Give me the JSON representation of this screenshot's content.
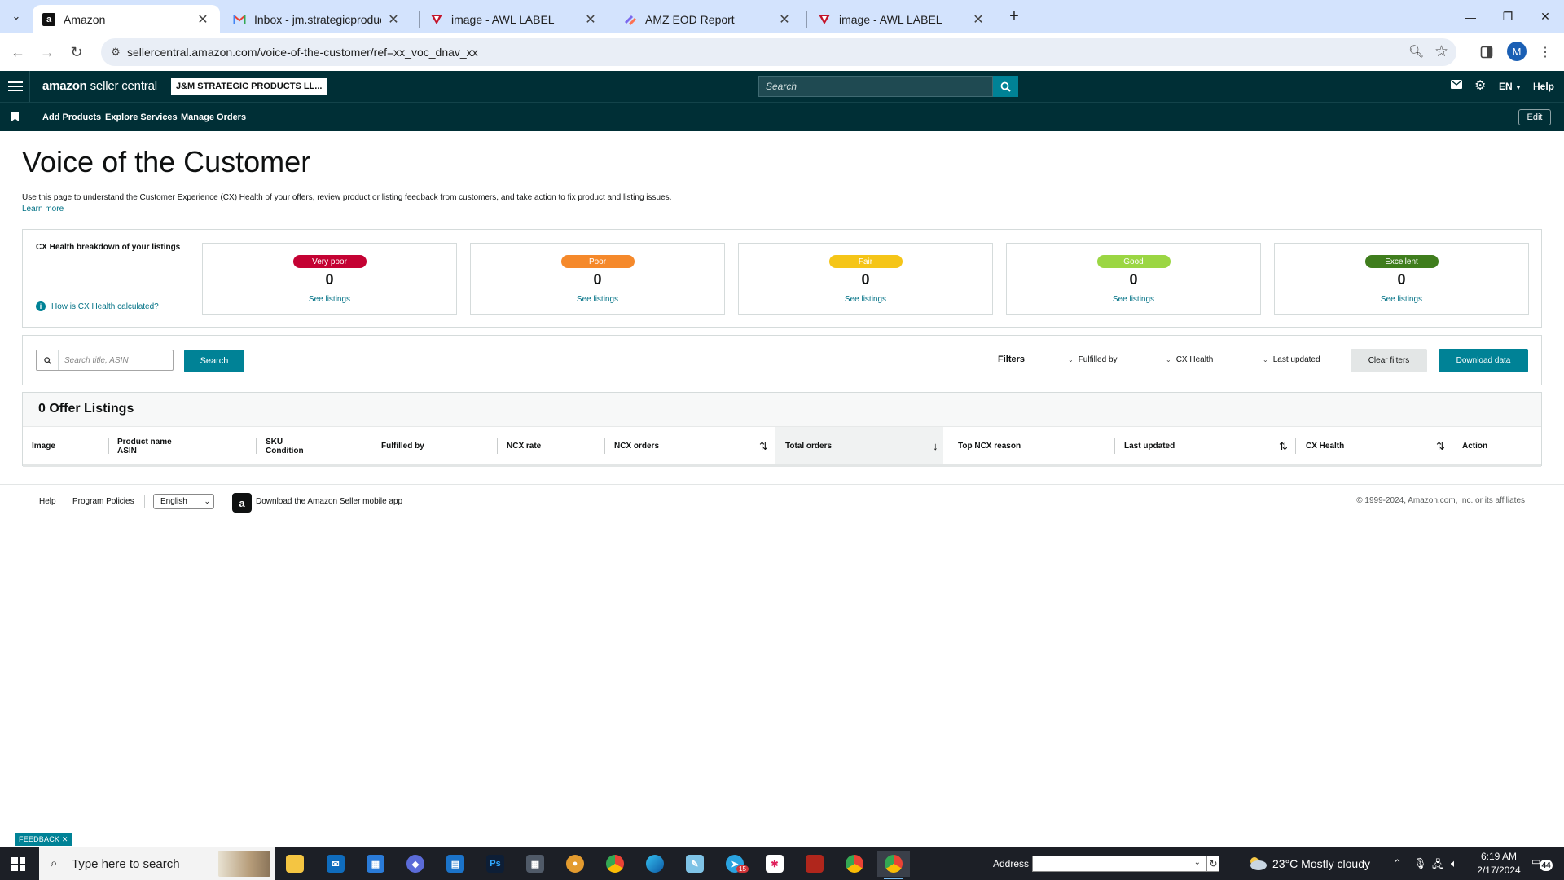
{
  "browser": {
    "tabs": [
      {
        "title": "Amazon",
        "icon": "amazon-icon",
        "active": true
      },
      {
        "title": "Inbox - jm.strategicproducts@g",
        "icon": "gmail-icon",
        "active": false
      },
      {
        "title": "image - AWL LABEL",
        "icon": "awl-icon",
        "active": false
      },
      {
        "title": "AMZ EOD Report",
        "icon": "clickup-icon",
        "active": false
      },
      {
        "title": "image - AWL LABEL",
        "icon": "awl-icon",
        "active": false
      }
    ],
    "url": "sellercentral.amazon.com/voice-of-the-customer/ref=xx_voc_dnav_xx",
    "profile_initial": "M"
  },
  "header": {
    "brand_bold": "amazon",
    "brand_rest": " seller central",
    "store": "J&M STRATEGIC PRODUCTS LL...",
    "search_placeholder": "Search",
    "language": "EN",
    "help": "Help"
  },
  "subnav": {
    "links": [
      "Add Products",
      "Explore Services",
      "Manage Orders"
    ],
    "edit": "Edit"
  },
  "page": {
    "title": "Voice of the Customer",
    "intro": "Use this page to understand the Customer Experience (CX) Health of your offers, review product or listing feedback from customers, and take action to fix product and listing issues.",
    "learn_more": "Learn more"
  },
  "cx_health": {
    "label": "CX Health breakdown of your listings",
    "help_link": "How is CX Health calculated?",
    "cards": [
      {
        "badge": "Very poor",
        "color": "#c40233",
        "count": "0",
        "link": "See listings"
      },
      {
        "badge": "Poor",
        "color": "#f5892b",
        "count": "0",
        "link": "See listings"
      },
      {
        "badge": "Fair",
        "color": "#f5c518",
        "count": "0",
        "link": "See listings"
      },
      {
        "badge": "Good",
        "color": "#9bd643",
        "count": "0",
        "link": "See listings"
      },
      {
        "badge": "Excellent",
        "color": "#3f7d1d",
        "count": "0",
        "link": "See listings"
      }
    ]
  },
  "filters": {
    "search_placeholder": "Search title, ASIN",
    "search_button": "Search",
    "label": "Filters",
    "selects": [
      "Fulfilled by",
      "CX Health",
      "Last updated"
    ],
    "clear": "Clear filters",
    "download": "Download data"
  },
  "listings": {
    "title": "0 Offer Listings",
    "columns": [
      {
        "line1": "Image",
        "line2": ""
      },
      {
        "line1": "Product name",
        "line2": "ASIN"
      },
      {
        "line1": "SKU",
        "line2": "Condition"
      },
      {
        "line1": "Fulfilled by",
        "line2": ""
      },
      {
        "line1": "NCX rate",
        "line2": ""
      },
      {
        "line1": "NCX orders",
        "line2": ""
      },
      {
        "line1": "Total orders",
        "line2": ""
      },
      {
        "line1": "Top NCX reason",
        "line2": ""
      },
      {
        "line1": "Last updated",
        "line2": ""
      },
      {
        "line1": "CX Health",
        "line2": ""
      },
      {
        "line1": "Action",
        "line2": ""
      }
    ]
  },
  "footer": {
    "help": "Help",
    "policies": "Program Policies",
    "language": "English",
    "app": "Download the Amazon Seller mobile app",
    "copyright": "© 1999-2024, Amazon.com, Inc. or its affiliates"
  },
  "feedback": "FEEDBACK",
  "taskbar": {
    "search_placeholder": "Type here to search",
    "address_label": "Address",
    "weather": "23°C  Mostly cloudy",
    "time": "6:19 AM",
    "date": "2/17/2024",
    "notifications": "44",
    "badge_count": "15"
  }
}
